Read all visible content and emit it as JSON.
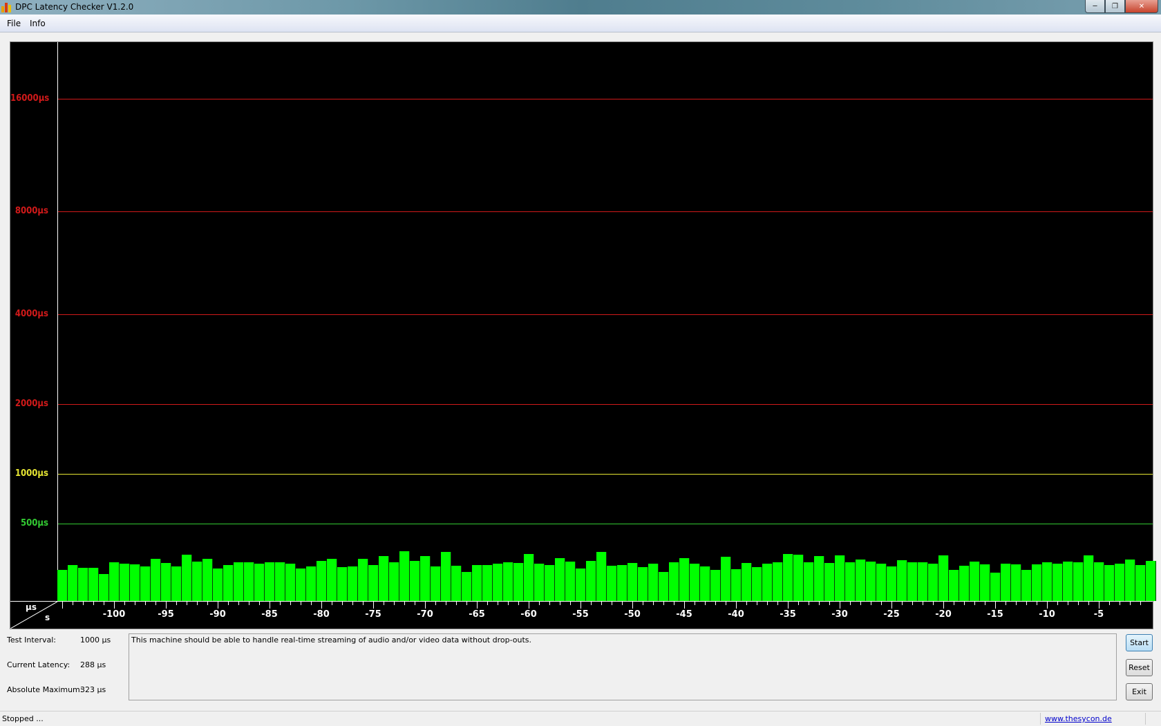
{
  "window": {
    "title": "DPC Latency Checker V1.2.0",
    "app_icon": "bar-chart-icon",
    "buttons": {
      "minimize": "minimize-icon",
      "maximize": "restore-icon",
      "close": "close-icon"
    }
  },
  "menu": {
    "items": [
      {
        "label": "File"
      },
      {
        "label": "Info"
      }
    ]
  },
  "chart_data": {
    "type": "bar",
    "xlabel": "s",
    "ylabel": "µs",
    "x": [
      -105,
      -104,
      -103,
      -102,
      -101,
      -100,
      -99,
      -98,
      -97,
      -96,
      -95,
      -94,
      -93,
      -92,
      -91,
      -90,
      -89,
      -88,
      -87,
      -86,
      -85,
      -84,
      -83,
      -82,
      -81,
      -80,
      -79,
      -78,
      -77,
      -76,
      -75,
      -74,
      -73,
      -72,
      -71,
      -70,
      -69,
      -68,
      -67,
      -66,
      -65,
      -64,
      -63,
      -62,
      -61,
      -60,
      -59,
      -58,
      -57,
      -56,
      -55,
      -54,
      -53,
      -52,
      -51,
      -50,
      -49,
      -48,
      -47,
      -46,
      -45,
      -44,
      -43,
      -42,
      -41,
      -40,
      -39,
      -38,
      -37,
      -36,
      -35,
      -34,
      -33,
      -32,
      -31,
      -30,
      -29,
      -28,
      -27,
      -26,
      -25,
      -24,
      -23,
      -22,
      -21,
      -20,
      -19,
      -18,
      -17,
      -16,
      -15,
      -14,
      -13,
      -12,
      -11,
      -10,
      -9,
      -8,
      -7,
      -6,
      -5,
      -4,
      -3,
      -2,
      -1,
      0
    ],
    "values": [
      200,
      232,
      216,
      216,
      172,
      252,
      240,
      236,
      224,
      272,
      244,
      224,
      300,
      256,
      272,
      208,
      232,
      252,
      248,
      240,
      252,
      252,
      240,
      212,
      224,
      260,
      272,
      220,
      224,
      272,
      232,
      288,
      248,
      323,
      260,
      288,
      224,
      316,
      228,
      188,
      232,
      232,
      240,
      252,
      244,
      304,
      240,
      232,
      276,
      256,
      208,
      260,
      316,
      228,
      232,
      244,
      220,
      240,
      188,
      252,
      276,
      240,
      224,
      200,
      284,
      204,
      244,
      220,
      240,
      252,
      304,
      300,
      252,
      288,
      244,
      296,
      248,
      268,
      256,
      240,
      224,
      264,
      252,
      248,
      240,
      296,
      200,
      228,
      256,
      236,
      184,
      240,
      236,
      200,
      236,
      248,
      240,
      256,
      252,
      296,
      248,
      232,
      240,
      268,
      232,
      260
    ],
    "bar_color": "#00ff00",
    "y_ticks": [
      {
        "value": 500,
        "label": "500µs",
        "color": "#33cc33"
      },
      {
        "value": 1000,
        "label": "1000µs",
        "color": "#e6e633"
      },
      {
        "value": 2000,
        "label": "2000µs",
        "color": "#d21a1a"
      },
      {
        "value": 4000,
        "label": "4000µs",
        "color": "#d21a1a"
      },
      {
        "value": 8000,
        "label": "8000µs",
        "color": "#d21a1a"
      },
      {
        "value": 16000,
        "label": "16000µs",
        "color": "#d21a1a"
      }
    ],
    "x_tick_labels": [
      "-100",
      "-95",
      "-90",
      "-85",
      "-80",
      "-75",
      "-70",
      "-65",
      "-60",
      "-55",
      "-50",
      "-45",
      "-40",
      "-35",
      "-30",
      "-25",
      "-20",
      "-15",
      "-10",
      "-5"
    ],
    "xlim": [
      -105,
      0
    ],
    "grid": "horizontal at y ticks"
  },
  "info": {
    "test_interval_label": "Test Interval:",
    "test_interval_value": "1000 µs",
    "current_latency_label": "Current Latency:",
    "current_latency_value": "288 µs",
    "absolute_maximum_label": "Absolute Maximum:",
    "absolute_maximum_value": "323 µs",
    "message": "This machine should be able to handle real-time streaming of audio and/or video data without drop-outs."
  },
  "buttons": {
    "start": "Start",
    "reset": "Reset",
    "exit": "Exit"
  },
  "status": {
    "text": "Stopped ...",
    "link": "www.thesycon.de"
  }
}
